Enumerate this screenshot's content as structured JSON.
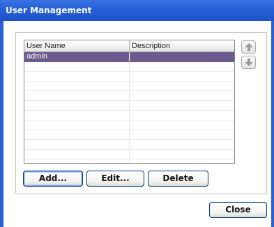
{
  "window": {
    "title": "User Management"
  },
  "table": {
    "columns": [
      "User Name",
      "Description"
    ],
    "rows": [
      {
        "name": "admin",
        "description": "",
        "selected": true
      }
    ],
    "empty_rows": 11
  },
  "buttons": {
    "add": "Add...",
    "edit": "Edit...",
    "delete": "Delete",
    "close": "Close"
  },
  "icons": {
    "move_up": "arrow-up-icon",
    "move_down": "arrow-down-icon"
  },
  "colors": {
    "titlebar": "#2560d8",
    "selection": "#6a5a8e",
    "button_border": "#003c74"
  }
}
